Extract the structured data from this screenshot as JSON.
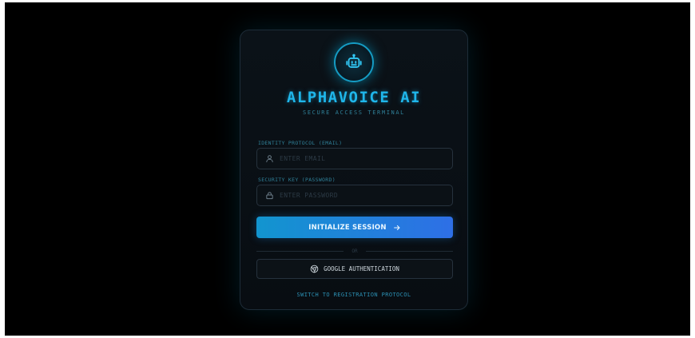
{
  "brand": {
    "title": "ALPHAVOICE AI",
    "subtitle": "SECURE ACCESS TERMINAL",
    "logo_icon": "robot-icon",
    "accent_color": "#1fb6ea"
  },
  "form": {
    "email": {
      "label": "IDENTITY PROTOCOL (EMAIL)",
      "placeholder": "ENTER EMAIL",
      "value": "",
      "icon": "user-icon"
    },
    "password": {
      "label": "SECURITY KEY (PASSWORD)",
      "placeholder": "ENTER PASSWORD",
      "value": "",
      "icon": "lock-icon"
    },
    "submit_label": "INITIALIZE SESSION",
    "submit_icon": "arrow-right-icon"
  },
  "divider": {
    "text": "OR"
  },
  "google": {
    "label": "GOOGLE AUTHENTICATION",
    "icon": "chrome-icon"
  },
  "switch_link": {
    "label": "SWITCH TO REGISTRATION PROTOCOL"
  }
}
